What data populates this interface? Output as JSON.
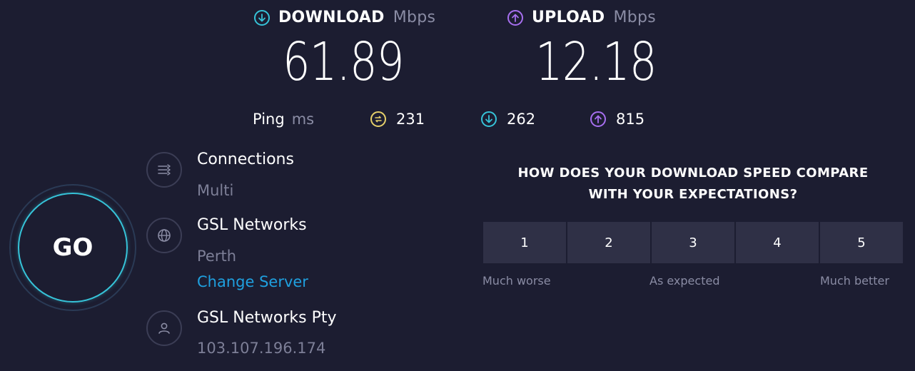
{
  "download": {
    "label": "DOWNLOAD",
    "unit": "Mbps",
    "value": "61.89",
    "icon": "download-arrow-icon",
    "color": "#36c3d8"
  },
  "upload": {
    "label": "UPLOAD",
    "unit": "Mbps",
    "value": "12.18",
    "icon": "upload-arrow-icon",
    "color": "#a76ff0"
  },
  "ping": {
    "label": "Ping",
    "unit": "ms",
    "idle": {
      "value": "231",
      "icon": "idle-ping-icon",
      "color": "#e6d06a"
    },
    "download": {
      "value": "262",
      "icon": "download-ping-icon",
      "color": "#36c3d8"
    },
    "upload": {
      "value": "815",
      "icon": "upload-ping-icon",
      "color": "#a76ff0"
    }
  },
  "go_button": {
    "label": "GO"
  },
  "connections": {
    "title": "Connections",
    "value": "Multi",
    "icon": "connections-icon"
  },
  "server": {
    "title": "GSL Networks",
    "location": "Perth",
    "change_label": "Change Server",
    "icon": "globe-icon"
  },
  "provider": {
    "title": "GSL Networks Pty",
    "ip": "103.107.196.174",
    "icon": "user-icon"
  },
  "survey": {
    "question_line1": "HOW DOES YOUR DOWNLOAD SPEED COMPARE",
    "question_line2": "WITH YOUR EXPECTATIONS?",
    "options": [
      "1",
      "2",
      "3",
      "4",
      "5"
    ],
    "scale_low": "Much worse",
    "scale_mid": "As expected",
    "scale_high": "Much better"
  }
}
